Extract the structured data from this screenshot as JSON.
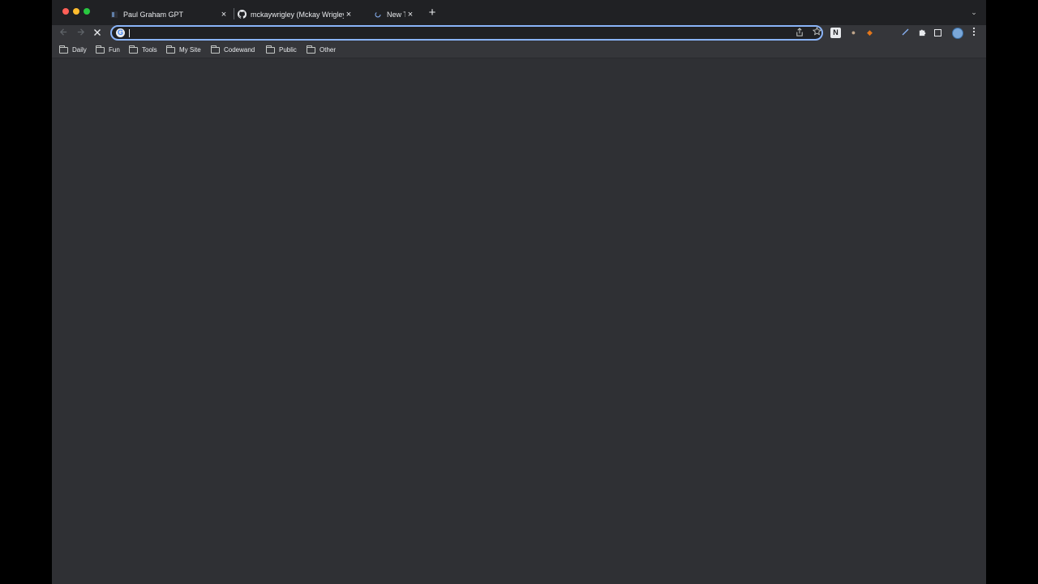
{
  "tabs": [
    {
      "title": "Paul Graham GPT",
      "favicon": "pg-icon"
    },
    {
      "title": "mckaywrigley (Mckay Wrigley)",
      "favicon": "github-icon"
    },
    {
      "title": "New Tab",
      "favicon": "loading-icon",
      "active": true
    }
  ],
  "tab_close_glyph": "×",
  "new_tab_glyph": "+",
  "tab_search_glyph": "⌄",
  "omnibox": {
    "value": "",
    "placeholder": ""
  },
  "bookmarks": [
    {
      "label": "Daily"
    },
    {
      "label": "Fun"
    },
    {
      "label": "Tools"
    },
    {
      "label": "My Site"
    },
    {
      "label": "Codewand"
    },
    {
      "label": "Public"
    },
    {
      "label": "Other"
    }
  ],
  "colors": {
    "window_bg": "#202124",
    "toolbar_bg": "#35363a",
    "content_bg": "#2f3034",
    "accent": "#8ab4f8"
  }
}
